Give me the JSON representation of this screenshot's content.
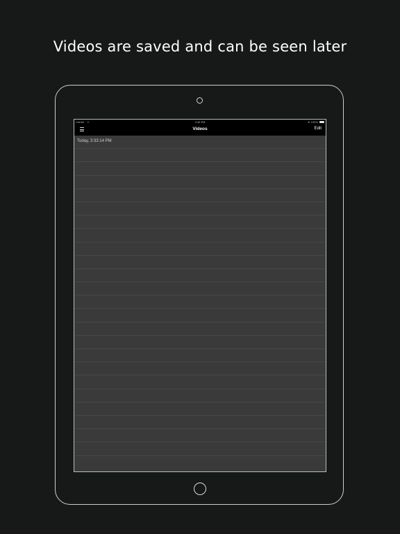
{
  "headline": "Videos are saved and can be seen later",
  "status_bar": {
    "carrier": "Carrier",
    "wifi_icon": "wifi-icon",
    "time": "3:35 PM",
    "battery_text": "100%",
    "location_icon": "location-arrow-icon"
  },
  "nav_bar": {
    "menu_icon": "hamburger-menu-icon",
    "title": "Videos",
    "edit_label": "Edit"
  },
  "videos": [
    {
      "label": "Today, 3:33:14 PM"
    }
  ],
  "colors": {
    "background": "#171818",
    "screen_background": "#3a3a3a",
    "nav_background": "#000000",
    "separator": "#474747",
    "text": "#ffffff"
  }
}
